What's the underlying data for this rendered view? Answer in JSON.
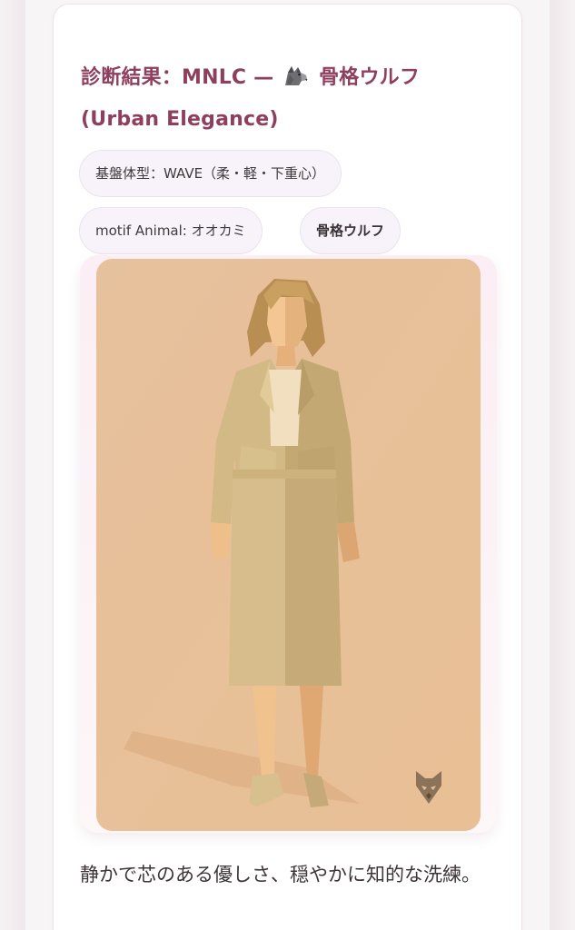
{
  "result": {
    "title_prefix": "診断結果：MNLC —",
    "title_type": "骨格ウルフ",
    "title_subtitle": "(Urban Elegance)",
    "title_icon": "wolf-icon"
  },
  "chips": {
    "base_body_type": "基盤体型：WAVE（柔・軽・下重心）",
    "motif_animal": "motif Animal: オオカミ",
    "type_name": "骨格ウルフ"
  },
  "illustration": {
    "subject": "woman-in-beige-skirt-suit",
    "badge_icon": "fox-wolf-head-icon",
    "background_color": "#e7c19b"
  },
  "description": "静かで芯のある優しさ、穏やかに知的な洗練。",
  "colors": {
    "accent": "#8e3f5e",
    "chip_bg": "#f8f3fa",
    "text": "#3d3538"
  }
}
